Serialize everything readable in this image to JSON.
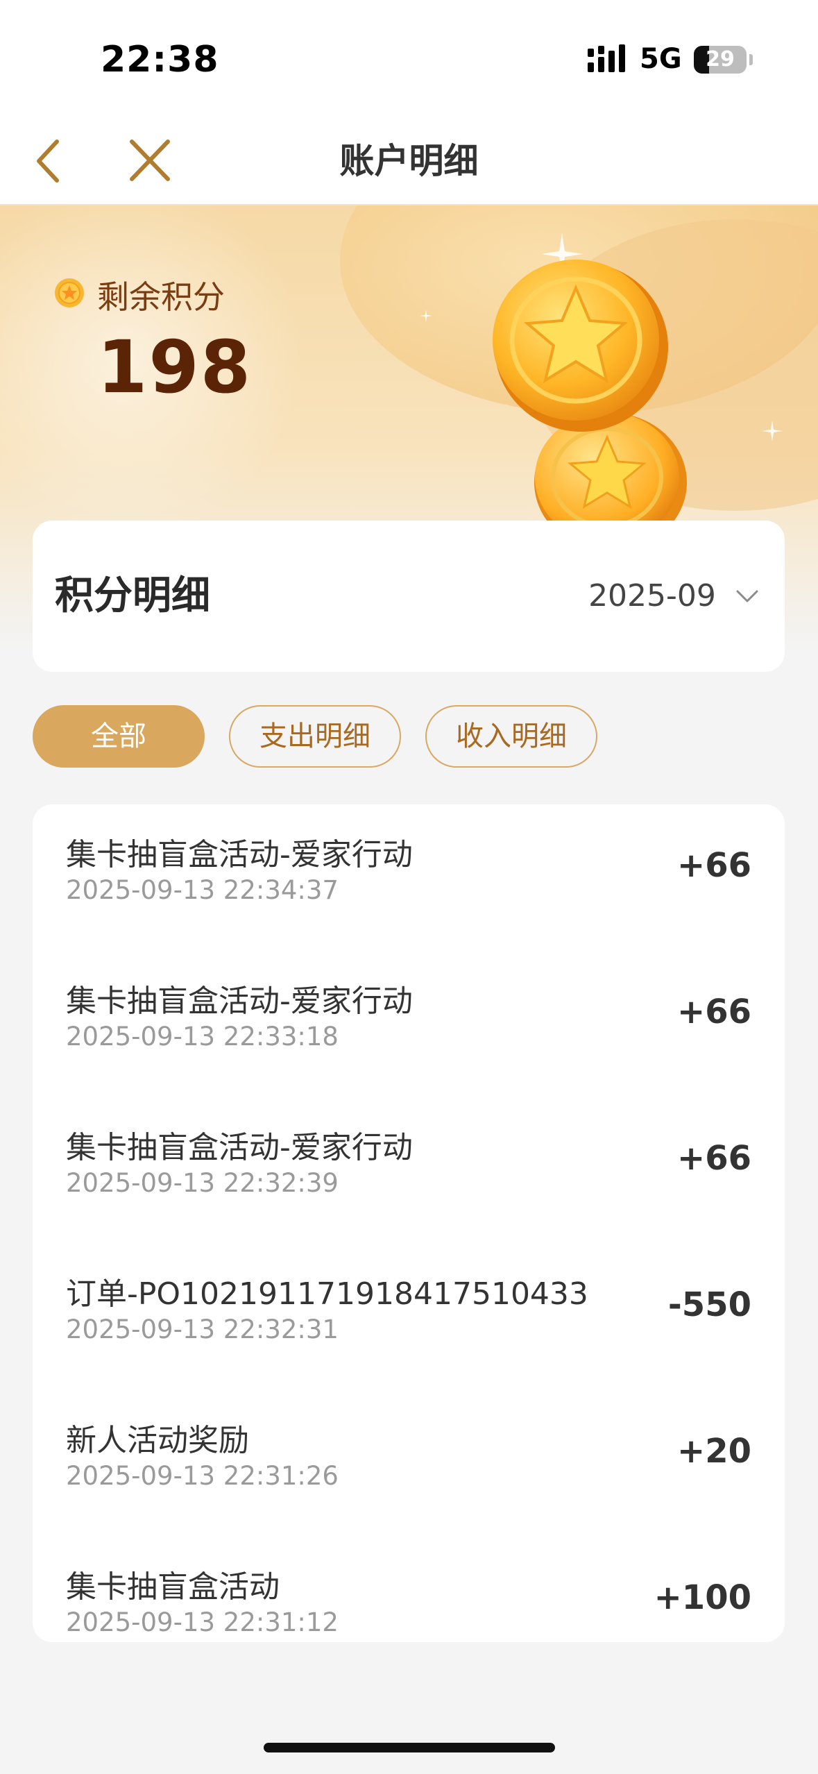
{
  "status_bar": {
    "time": "22:38",
    "network": "5G",
    "battery": "29",
    "battery_level_percent": 29
  },
  "nav": {
    "title": "账户明细",
    "back_icon": "chevron-left-icon",
    "close_icon": "close-icon"
  },
  "summary": {
    "label": "剩余积分",
    "value": "198"
  },
  "detail": {
    "title": "积分明细",
    "month": "2025-09"
  },
  "filters": [
    {
      "label": "全部",
      "active": true
    },
    {
      "label": "支出明细",
      "active": false
    },
    {
      "label": "收入明细",
      "active": false
    }
  ],
  "transactions": [
    {
      "title": "集卡抽盲盒活动-爱家行动",
      "time": "2025-09-13 22:34:37",
      "amount": "+66"
    },
    {
      "title": "集卡抽盲盒活动-爱家行动",
      "time": "2025-09-13 22:33:18",
      "amount": "+66"
    },
    {
      "title": "集卡抽盲盒活动-爱家行动",
      "time": "2025-09-13 22:32:39",
      "amount": "+66"
    },
    {
      "title": "订单-PO102191171918417510433",
      "time": "2025-09-13 22:32:31",
      "amount": "-550"
    },
    {
      "title": "新人活动奖励",
      "time": "2025-09-13 22:31:26",
      "amount": "+20"
    },
    {
      "title": "集卡抽盲盒活动",
      "time": "2025-09-13 22:31:12",
      "amount": "+100"
    }
  ],
  "colors": {
    "accent": "#d9a75e",
    "nav_icon": "#b07d2e",
    "points_text": "#5c2406"
  }
}
